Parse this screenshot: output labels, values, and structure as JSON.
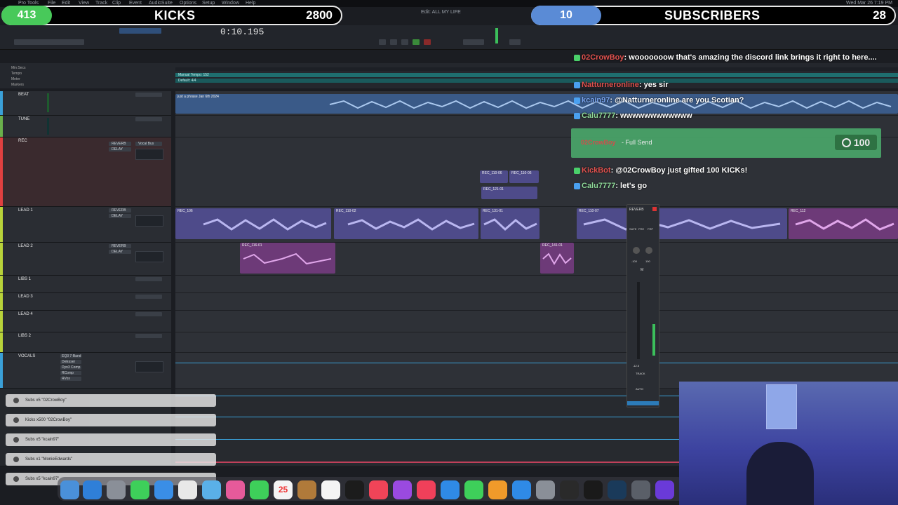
{
  "menubar": {
    "items": [
      "Pro Tools",
      "File",
      "Edit",
      "View",
      "Track",
      "Clip",
      "Event",
      "AudioSuite",
      "Options",
      "Setup",
      "Window",
      "Help"
    ],
    "clock": "Wed Mar 26  7:19 PM"
  },
  "kicks_bar": {
    "count": "413",
    "title": "KICKS",
    "goal": "2800",
    "color": "#48c95a"
  },
  "subs_bar": {
    "count": "10",
    "title": "SUBSCRIBERS",
    "goal": "28",
    "color": "#5a8bd6"
  },
  "session": {
    "title": "Edit: ALL MY LIFE",
    "counter": "0:10.195"
  },
  "rulers": {
    "labels": [
      "Min:Secs",
      "Tempo",
      "Meter",
      "Markers"
    ],
    "tempo_text": "Manual Tempo: 152",
    "meter_text": "Default: 4/4"
  },
  "tracks": [
    {
      "name": "BEAT",
      "color": "#3aa0d8"
    },
    {
      "name": "TUNE",
      "color": "#6ab04c"
    },
    {
      "name": "REC",
      "color": "#e04040",
      "ins": [
        "REVERB",
        "DELAY"
      ],
      "io": "Vocal Bus"
    },
    {
      "name": "LEAD 1",
      "color": "#b8d23a",
      "ins": [
        "REVERB",
        "DELAY"
      ]
    },
    {
      "name": "LEAD 2",
      "color": "#b8d23a",
      "ins": [
        "REVERB",
        "DELAY"
      ]
    },
    {
      "name": "LIBS 1",
      "color": "#b8d23a"
    },
    {
      "name": "LEAD 3",
      "color": "#b8d23a"
    },
    {
      "name": "LEAD 4",
      "color": "#b8d23a"
    },
    {
      "name": "LIBS 2",
      "color": "#b8d23a"
    },
    {
      "name": "VOCALS",
      "color": "#3aa0d8",
      "ins": [
        "EQ3 7-Band",
        "DeEsser",
        "Dyn3 Comp",
        "RComp",
        "RVox"
      ]
    }
  ],
  "clips": {
    "beat": "just a phrase Jan 6th 2024",
    "rec": [
      "REC_110-06",
      "REC_110-06",
      "REC_121-01"
    ],
    "lead1": [
      "REC_106",
      "REC_110-02",
      "REC_131-01",
      "REC_110-07",
      "REC_112"
    ],
    "lead2": [
      "REC_116-01",
      "REC_141-01"
    ]
  },
  "chat": [
    {
      "user": "02CrowBoy",
      "user_color": "red",
      "text": ": wooooooow that's amazing the discord link brings it right to here...."
    },
    {
      "user": "Natturneronline",
      "user_color": "red",
      "text": ": yes sir"
    },
    {
      "user": "kcain97",
      "user_color": "blue",
      "text": ": @Natturneronline are you Scotian?"
    },
    {
      "user": "Calu7777",
      "user_color": "green",
      "text": ": wwwwwwwwwwww"
    },
    {
      "user": "KickBot",
      "user_color": "red",
      "text": ": @02CrowBoy just gifted 100 KICKs!"
    },
    {
      "user": "Calu7777",
      "user_color": "green",
      "text": ": let's go"
    }
  ],
  "send_alert": {
    "user": "02CrowBoy",
    "label": "- Full Send",
    "amount": "100"
  },
  "alerts": [
    {
      "text": "Subs x5 \"02CrowBoy\""
    },
    {
      "text": "Kicks x500 \"02CrowBoy\""
    },
    {
      "text": "Subs x5 \"kcain97\""
    },
    {
      "text": "Subs x1 \"MonieEdwards\""
    },
    {
      "text": "Subs x5 \"kcain97\""
    }
  ],
  "mini_mixer": {
    "labels": [
      "REVERB",
      "SAFE",
      "PRE",
      "FRP",
      "M",
      "TRACK",
      "AUTO"
    ],
    "values": [
      "-100",
      "100",
      "-12.5"
    ]
  },
  "dock": {
    "calendar_day": "25",
    "calendar_month": "MAR"
  }
}
